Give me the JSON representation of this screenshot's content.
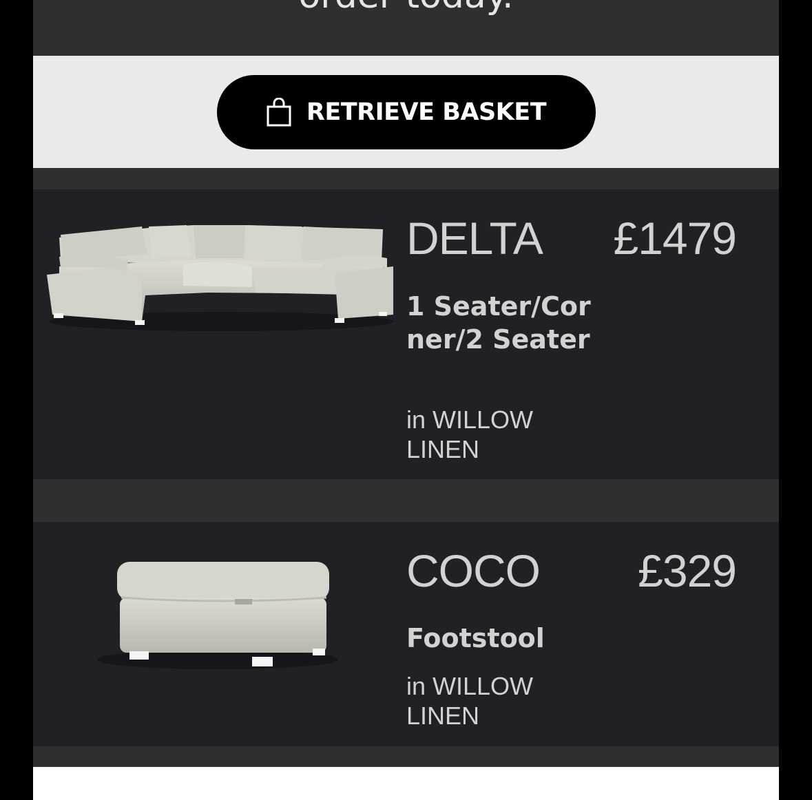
{
  "header": {
    "text": "order today."
  },
  "basket": {
    "button_label": "RETRIEVE BASKET"
  },
  "items": [
    {
      "name": "DELTA",
      "price": "£1479",
      "description": "1 Seater/Corner/2 Seater",
      "fabric": "in WILLOW LINEN",
      "image": "corner-sofa"
    },
    {
      "name": "COCO",
      "price": "£329",
      "description": "Footstool",
      "fabric": "in WILLOW LINEN",
      "image": "storage-footstool"
    }
  ],
  "colors": {
    "page": "#2f2f31",
    "item_bg": "#202125",
    "button": "#000000",
    "band": "#eaeaea",
    "text": "#d2d2d2"
  }
}
